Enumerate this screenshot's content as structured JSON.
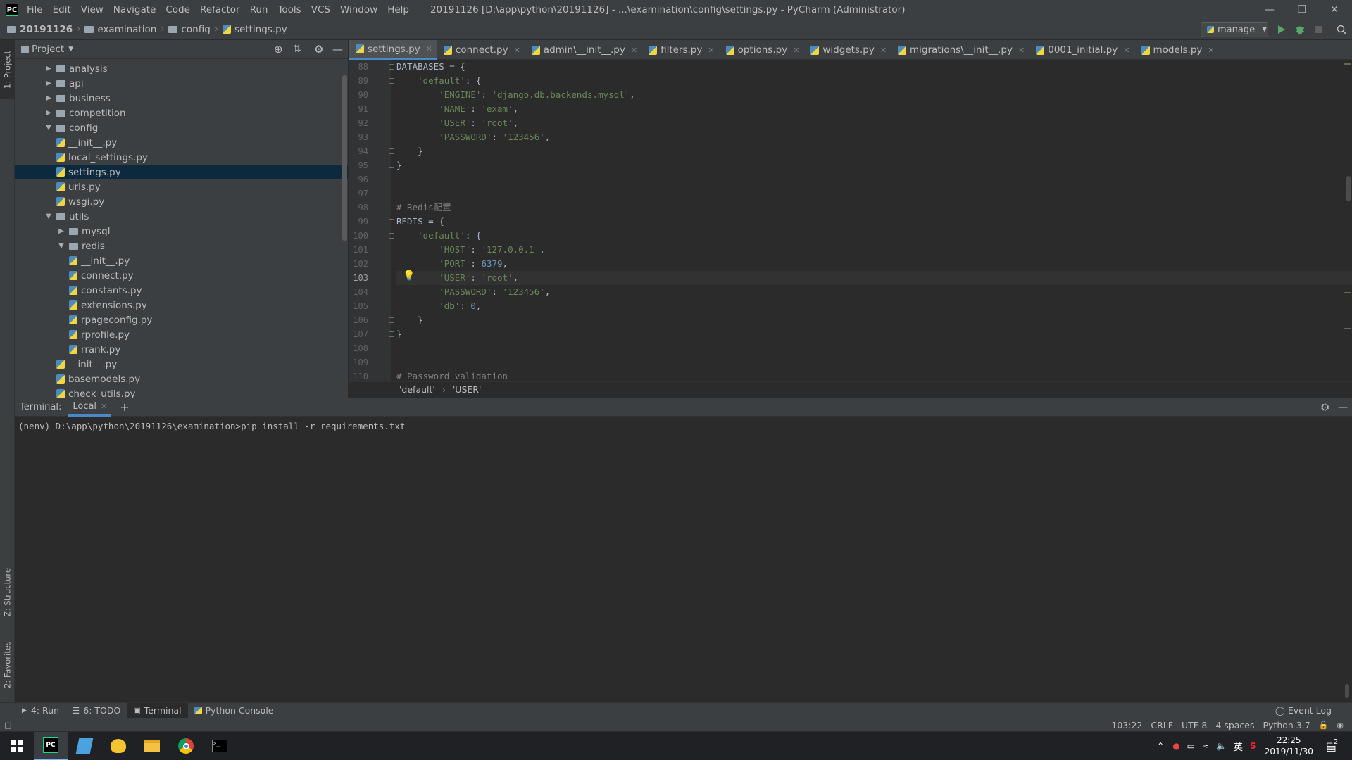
{
  "title_bar": {
    "menus": [
      "File",
      "Edit",
      "View",
      "Navigate",
      "Code",
      "Refactor",
      "Run",
      "Tools",
      "VCS",
      "Window",
      "Help"
    ],
    "window_title": "20191126 [D:\\app\\python\\20191126] - ...\\examination\\config\\settings.py - PyCharm (Administrator)",
    "logo": "PC"
  },
  "nav_bar": {
    "crumbs": [
      "20191126",
      "examination",
      "config",
      "settings.py"
    ],
    "run_config": "manage"
  },
  "left_strip": {
    "project_tab": "1: Project",
    "structure_tab": "Z: Structure",
    "favorites_tab": "2: Favorites"
  },
  "project_panel": {
    "title": "Project",
    "tree": [
      {
        "label": "analysis",
        "type": "folder",
        "level": 0,
        "expanded": false
      },
      {
        "label": "api",
        "type": "folder",
        "level": 0,
        "expanded": false
      },
      {
        "label": "business",
        "type": "folder",
        "level": 0,
        "expanded": false
      },
      {
        "label": "competition",
        "type": "folder",
        "level": 0,
        "expanded": false
      },
      {
        "label": "config",
        "type": "folder",
        "level": 0,
        "expanded": true
      },
      {
        "label": "__init__.py",
        "type": "py",
        "level": 1
      },
      {
        "label": "local_settings.py",
        "type": "py",
        "level": 1
      },
      {
        "label": "settings.py",
        "type": "py",
        "level": 1,
        "selected": true
      },
      {
        "label": "urls.py",
        "type": "py",
        "level": 1
      },
      {
        "label": "wsgi.py",
        "type": "py",
        "level": 1
      },
      {
        "label": "utils",
        "type": "folder",
        "level": 0,
        "expanded": true
      },
      {
        "label": "mysql",
        "type": "folder",
        "level": 1,
        "expanded": false
      },
      {
        "label": "redis",
        "type": "folder",
        "level": 1,
        "expanded": true
      },
      {
        "label": "__init__.py",
        "type": "py",
        "level": 2
      },
      {
        "label": "connect.py",
        "type": "py",
        "level": 2
      },
      {
        "label": "constants.py",
        "type": "py",
        "level": 2
      },
      {
        "label": "extensions.py",
        "type": "py",
        "level": 2
      },
      {
        "label": "rpageconfig.py",
        "type": "py",
        "level": 2
      },
      {
        "label": "rprofile.py",
        "type": "py",
        "level": 2
      },
      {
        "label": "rrank.py",
        "type": "py",
        "level": 2
      },
      {
        "label": "__init__.py",
        "type": "py",
        "level": 1
      },
      {
        "label": "basemodels.py",
        "type": "py",
        "level": 1
      },
      {
        "label": "check_utils.py",
        "type": "py",
        "level": 1
      }
    ]
  },
  "editor": {
    "tabs": [
      "settings.py",
      "connect.py",
      "admin\\__init__.py",
      "filters.py",
      "options.py",
      "widgets.py",
      "migrations\\__init__.py",
      "0001_initial.py",
      "models.py"
    ],
    "active_tab": 0,
    "current_line": 103,
    "lines": [
      {
        "n": "88",
        "tokens": [
          {
            "t": "DATABASES = {",
            "c": ""
          }
        ]
      },
      {
        "n": "89",
        "tokens": [
          {
            "t": "    ",
            "c": ""
          },
          {
            "t": "'default'",
            "c": "str"
          },
          {
            "t": ": {",
            "c": ""
          }
        ]
      },
      {
        "n": "90",
        "tokens": [
          {
            "t": "        ",
            "c": ""
          },
          {
            "t": "'ENGINE'",
            "c": "str"
          },
          {
            "t": ": ",
            "c": ""
          },
          {
            "t": "'django.db.backends.mysql'",
            "c": "str"
          },
          {
            "t": ",",
            "c": ""
          }
        ]
      },
      {
        "n": "91",
        "tokens": [
          {
            "t": "        ",
            "c": ""
          },
          {
            "t": "'NAME'",
            "c": "str"
          },
          {
            "t": ": ",
            "c": ""
          },
          {
            "t": "'exam'",
            "c": "str"
          },
          {
            "t": ",",
            "c": ""
          }
        ]
      },
      {
        "n": "92",
        "tokens": [
          {
            "t": "        ",
            "c": ""
          },
          {
            "t": "'USER'",
            "c": "str"
          },
          {
            "t": ": ",
            "c": ""
          },
          {
            "t": "'root'",
            "c": "str"
          },
          {
            "t": ",",
            "c": ""
          }
        ]
      },
      {
        "n": "93",
        "tokens": [
          {
            "t": "        ",
            "c": ""
          },
          {
            "t": "'PASSWORD'",
            "c": "str"
          },
          {
            "t": ": ",
            "c": ""
          },
          {
            "t": "'123456'",
            "c": "str"
          },
          {
            "t": ",",
            "c": ""
          }
        ]
      },
      {
        "n": "94",
        "tokens": [
          {
            "t": "    }",
            "c": ""
          }
        ]
      },
      {
        "n": "95",
        "tokens": [
          {
            "t": "}",
            "c": ""
          }
        ]
      },
      {
        "n": "96",
        "tokens": []
      },
      {
        "n": "97",
        "tokens": []
      },
      {
        "n": "98",
        "tokens": [
          {
            "t": "# Redis配置",
            "c": "cmt"
          }
        ]
      },
      {
        "n": "99",
        "tokens": [
          {
            "t": "REDIS = {",
            "c": ""
          }
        ]
      },
      {
        "n": "100",
        "tokens": [
          {
            "t": "    ",
            "c": ""
          },
          {
            "t": "'default'",
            "c": "str"
          },
          {
            "t": ": {",
            "c": ""
          }
        ]
      },
      {
        "n": "101",
        "tokens": [
          {
            "t": "        ",
            "c": ""
          },
          {
            "t": "'HOST'",
            "c": "str"
          },
          {
            "t": ": ",
            "c": ""
          },
          {
            "t": "'127.0.0.1'",
            "c": "str"
          },
          {
            "t": ",",
            "c": ""
          }
        ]
      },
      {
        "n": "102",
        "tokens": [
          {
            "t": "        ",
            "c": ""
          },
          {
            "t": "'PORT'",
            "c": "str"
          },
          {
            "t": ": ",
            "c": ""
          },
          {
            "t": "6379",
            "c": "num"
          },
          {
            "t": ",",
            "c": ""
          }
        ]
      },
      {
        "n": "103",
        "tokens": [
          {
            "t": "        ",
            "c": ""
          },
          {
            "t": "'USER'",
            "c": "str"
          },
          {
            "t": ": ",
            "c": ""
          },
          {
            "t": "'root'",
            "c": "str"
          },
          {
            "t": ",",
            "c": ""
          }
        ]
      },
      {
        "n": "104",
        "tokens": [
          {
            "t": "        ",
            "c": ""
          },
          {
            "t": "'PASSWORD'",
            "c": "str"
          },
          {
            "t": ": ",
            "c": ""
          },
          {
            "t": "'123456'",
            "c": "str"
          },
          {
            "t": ",",
            "c": ""
          }
        ]
      },
      {
        "n": "105",
        "tokens": [
          {
            "t": "        ",
            "c": ""
          },
          {
            "t": "'db'",
            "c": "str"
          },
          {
            "t": ": ",
            "c": ""
          },
          {
            "t": "0",
            "c": "num"
          },
          {
            "t": ",",
            "c": ""
          }
        ]
      },
      {
        "n": "106",
        "tokens": [
          {
            "t": "    }",
            "c": ""
          }
        ]
      },
      {
        "n": "107",
        "tokens": [
          {
            "t": "}",
            "c": ""
          }
        ]
      },
      {
        "n": "108",
        "tokens": []
      },
      {
        "n": "109",
        "tokens": []
      },
      {
        "n": "110",
        "tokens": [
          {
            "t": "# Password validation",
            "c": "cmt"
          }
        ]
      }
    ],
    "fold_lines": [
      "88",
      "89",
      "94",
      "95",
      "99",
      "100",
      "106",
      "107",
      "110"
    ],
    "breadcrumb": [
      "'default'",
      "'USER'"
    ],
    "crumb_sep": "›"
  },
  "terminal": {
    "label": "Terminal:",
    "tab": "Local",
    "new_tab": "+",
    "line": "(nenv) D:\\app\\python\\20191126\\examination>pip install -r requirements.txt"
  },
  "bottom_tools": [
    {
      "icon": "run-icon",
      "label": "4: Run"
    },
    {
      "icon": "todo-icon",
      "label": "6: TODO"
    },
    {
      "icon": "terminal-icon",
      "label": "Terminal",
      "active": true
    },
    {
      "icon": "python-console-icon",
      "label": "Python Console"
    }
  ],
  "event_log": "Event Log",
  "status_bar": {
    "position": "103:22",
    "line_sep": "CRLF",
    "encoding": "UTF-8",
    "indent": "4 spaces",
    "interpreter": "Python 3.7"
  },
  "taskbar": {
    "apps": [
      "start-icon",
      "pycharm-icon",
      "notepad-icon",
      "app-yellow-icon",
      "file-explorer-icon",
      "chrome-icon",
      "cmd-icon"
    ],
    "ime": "英",
    "time": "22:25",
    "date": "2019/11/30",
    "notifications": "2"
  },
  "colors": {
    "accent": "#4a88c7",
    "string": "#6a8759",
    "number": "#6897bb",
    "comment": "#808080",
    "selection": "#0d293e"
  }
}
